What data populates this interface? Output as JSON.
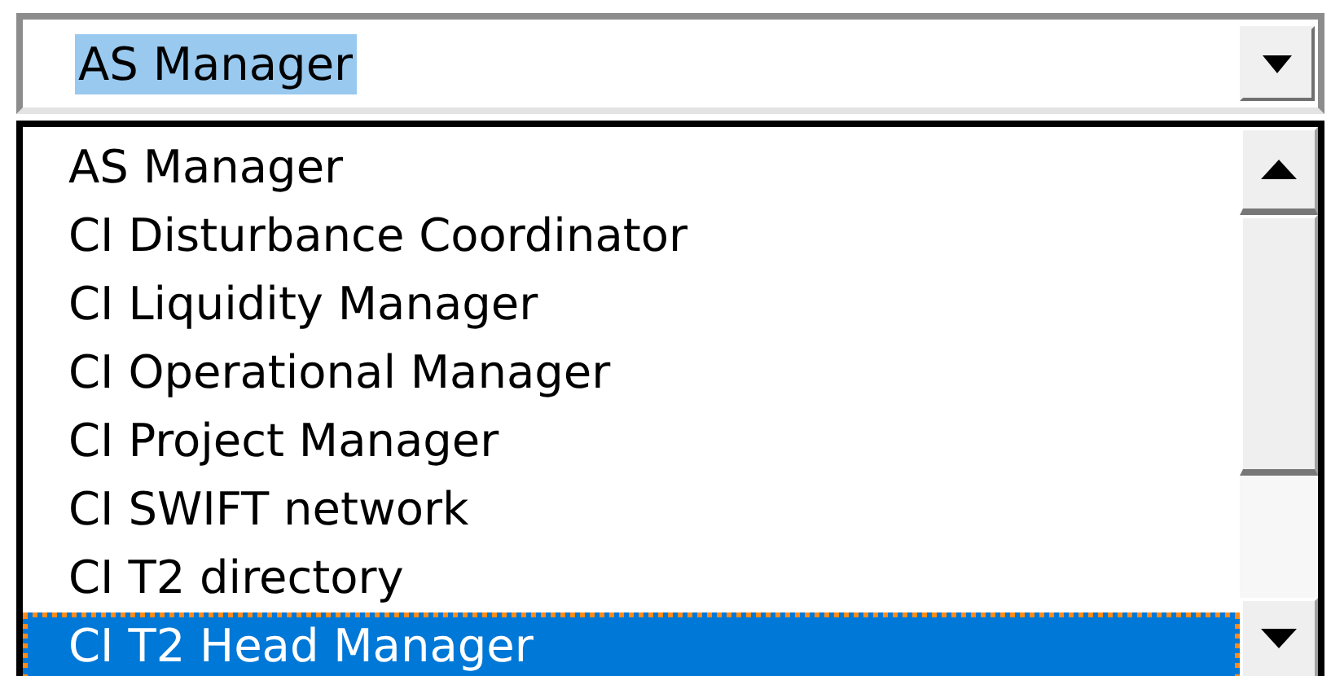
{
  "combo": {
    "value": "AS Manager",
    "value_highlighted": true
  },
  "options": [
    {
      "label": "AS Manager",
      "selected": false
    },
    {
      "label": "CI Disturbance Coordinator",
      "selected": false
    },
    {
      "label": "CI Liquidity Manager",
      "selected": false
    },
    {
      "label": "CI Operational Manager",
      "selected": false
    },
    {
      "label": "CI Project Manager",
      "selected": false
    },
    {
      "label": "CI SWIFT network",
      "selected": false
    },
    {
      "label": "CI T2 directory",
      "selected": false
    },
    {
      "label": "CI T2 Head Manager",
      "selected": true
    }
  ]
}
